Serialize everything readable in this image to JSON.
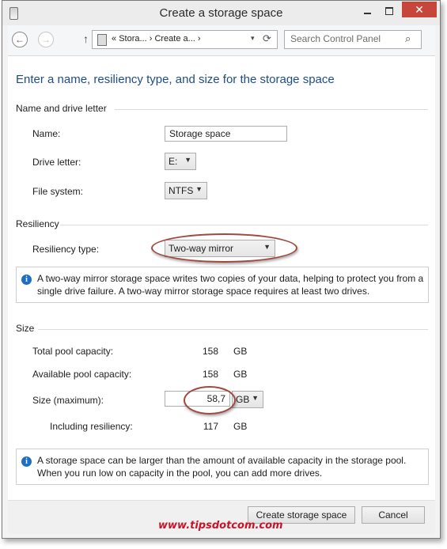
{
  "window": {
    "title": "Create a storage space"
  },
  "nav": {
    "back_icon": "←",
    "forward_icon": "→",
    "up_icon": "↑",
    "address": [
      "«",
      "Stora...",
      "›",
      "Create a...",
      "›"
    ],
    "dropdown_icon": "▾",
    "refresh_icon": "⟳",
    "search_placeholder": "Search Control Panel",
    "search_icon": "⌕"
  },
  "heading": "Enter a name, resiliency type, and size for the storage space",
  "name_section": {
    "group_label": "Name and drive letter",
    "name_label": "Name:",
    "name_value": "Storage space",
    "drive_label": "Drive letter:",
    "drive_value": "E:",
    "fs_label": "File system:",
    "fs_value": "NTFS"
  },
  "resiliency_section": {
    "group_label": "Resiliency",
    "type_label": "Resiliency type:",
    "type_value": "Two-way mirror",
    "info": "A two-way mirror storage space writes two copies of your data, helping to protect you from a single drive failure. A two-way mirror storage space requires at least two drives."
  },
  "size_section": {
    "group_label": "Size",
    "total_label": "Total pool capacity:",
    "total_value": "158",
    "total_unit": "GB",
    "available_label": "Available pool capacity:",
    "available_value": "158",
    "available_unit": "GB",
    "size_label": "Size (maximum):",
    "size_value": "58,7",
    "size_unit": "GB",
    "including_label": "Including resiliency:",
    "including_value": "117",
    "including_unit": "GB",
    "info": "A storage space can be larger than the amount of available capacity in the storage pool. When you run low on capacity in the pool, you can add more drives."
  },
  "footer": {
    "create_label": "Create storage space",
    "cancel_label": "Cancel"
  },
  "watermark": "www.tipsdotcom.com",
  "colors": {
    "accent_heading": "#1e4d86",
    "close_button": "#c7463b",
    "annotation_circle": "#a0483e",
    "watermark": "#c8142a"
  }
}
